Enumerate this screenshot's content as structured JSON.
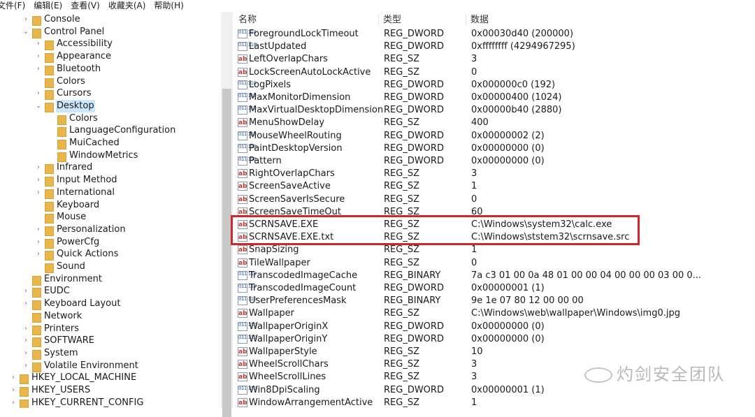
{
  "menu": [
    "文件(F)",
    "编辑(E)",
    "查看(V)",
    "收藏夹(A)",
    "帮助(H)"
  ],
  "tree": [
    {
      "label": "Console",
      "arrow": "›",
      "indent": 0
    },
    {
      "label": "Control Panel",
      "arrow": "⌄",
      "indent": 0
    },
    {
      "label": "Accessibility",
      "arrow": "›",
      "indent": 1
    },
    {
      "label": "Appearance",
      "arrow": "›",
      "indent": 1
    },
    {
      "label": "Bluetooth",
      "arrow": "›",
      "indent": 1
    },
    {
      "label": "Colors",
      "arrow": "",
      "indent": 1
    },
    {
      "label": "Cursors",
      "arrow": "›",
      "indent": 1
    },
    {
      "label": "Desktop",
      "arrow": "⌄",
      "indent": 1,
      "selected": true
    },
    {
      "label": "Colors",
      "arrow": "",
      "indent": 2
    },
    {
      "label": "LanguageConfiguration",
      "arrow": "",
      "indent": 2
    },
    {
      "label": "MuiCached",
      "arrow": "",
      "indent": 2
    },
    {
      "label": "WindowMetrics",
      "arrow": "",
      "indent": 2
    },
    {
      "label": "Infrared",
      "arrow": "›",
      "indent": 1
    },
    {
      "label": "Input Method",
      "arrow": "›",
      "indent": 1
    },
    {
      "label": "International",
      "arrow": "›",
      "indent": 1
    },
    {
      "label": "Keyboard",
      "arrow": "",
      "indent": 1
    },
    {
      "label": "Mouse",
      "arrow": "",
      "indent": 1
    },
    {
      "label": "Personalization",
      "arrow": "›",
      "indent": 1
    },
    {
      "label": "PowerCfg",
      "arrow": "›",
      "indent": 1
    },
    {
      "label": "Quick Actions",
      "arrow": "›",
      "indent": 1
    },
    {
      "label": "Sound",
      "arrow": "",
      "indent": 1
    },
    {
      "label": "Environment",
      "arrow": "",
      "indent": 0
    },
    {
      "label": "EUDC",
      "arrow": "›",
      "indent": 0
    },
    {
      "label": "Keyboard Layout",
      "arrow": "›",
      "indent": 0
    },
    {
      "label": "Network",
      "arrow": "",
      "indent": 0
    },
    {
      "label": "Printers",
      "arrow": "›",
      "indent": 0
    },
    {
      "label": "SOFTWARE",
      "arrow": "›",
      "indent": 0
    },
    {
      "label": "System",
      "arrow": "›",
      "indent": 0
    },
    {
      "label": "Volatile Environment",
      "arrow": "›",
      "indent": 0
    },
    {
      "label": "HKEY_LOCAL_MACHINE",
      "arrow": "›",
      "indent": -1
    },
    {
      "label": "HKEY_USERS",
      "arrow": "›",
      "indent": -1
    },
    {
      "label": "HKEY_CURRENT_CONFIG",
      "arrow": "›",
      "indent": -1
    }
  ],
  "columns": {
    "name": "名称",
    "type": "类型",
    "data": "数据"
  },
  "values": [
    {
      "icon": "dword",
      "name": "ForegroundLockTimeout",
      "type": "REG_DWORD",
      "data": "0x00030d40 (200000)"
    },
    {
      "icon": "dword",
      "name": "LastUpdated",
      "type": "REG_DWORD",
      "data": "0xffffffff (4294967295)"
    },
    {
      "icon": "sz",
      "name": "LeftOverlapChars",
      "type": "REG_SZ",
      "data": "3"
    },
    {
      "icon": "sz",
      "name": "LockScreenAutoLockActive",
      "type": "REG_SZ",
      "data": "0"
    },
    {
      "icon": "dword",
      "name": "LogPixels",
      "type": "REG_DWORD",
      "data": "0x000000c0 (192)"
    },
    {
      "icon": "dword",
      "name": "MaxMonitorDimension",
      "type": "REG_DWORD",
      "data": "0x00000400 (1024)"
    },
    {
      "icon": "dword",
      "name": "MaxVirtualDesktopDimension",
      "type": "REG_DWORD",
      "data": "0x00000b40 (2880)"
    },
    {
      "icon": "sz",
      "name": "MenuShowDelay",
      "type": "REG_SZ",
      "data": "400"
    },
    {
      "icon": "dword",
      "name": "MouseWheelRouting",
      "type": "REG_DWORD",
      "data": "0x00000002 (2)"
    },
    {
      "icon": "dword",
      "name": "PaintDesktopVersion",
      "type": "REG_DWORD",
      "data": "0x00000000 (0)"
    },
    {
      "icon": "dword",
      "name": "Pattern",
      "type": "REG_DWORD",
      "data": "0x00000000 (0)"
    },
    {
      "icon": "sz",
      "name": "RightOverlapChars",
      "type": "REG_SZ",
      "data": "3"
    },
    {
      "icon": "sz",
      "name": "ScreenSaveActive",
      "type": "REG_SZ",
      "data": "1"
    },
    {
      "icon": "sz",
      "name": "ScreenSaverIsSecure",
      "type": "REG_SZ",
      "data": "0"
    },
    {
      "icon": "sz",
      "name": "ScreenSaveTimeOut",
      "type": "REG_SZ",
      "data": "60"
    },
    {
      "icon": "sz",
      "name": "SCRNSAVE.EXE",
      "type": "REG_SZ",
      "data": "C:\\Windows\\system32\\calc.exe"
    },
    {
      "icon": "sz",
      "name": "SCRNSAVE.EXE.txt",
      "type": "REG_SZ",
      "data": "C:\\Windows\\ststem32\\scrnsave.src"
    },
    {
      "icon": "sz",
      "name": "SnapSizing",
      "type": "REG_SZ",
      "data": "1"
    },
    {
      "icon": "sz",
      "name": "TileWallpaper",
      "type": "REG_SZ",
      "data": "0"
    },
    {
      "icon": "dword",
      "name": "TranscodedImageCache",
      "type": "REG_BINARY",
      "data": "7a c3 01 00 0a 48 01 00 00 04 00 00 00 03 00 0..."
    },
    {
      "icon": "dword",
      "name": "TranscodedImageCount",
      "type": "REG_DWORD",
      "data": "0x00000001 (1)"
    },
    {
      "icon": "dword",
      "name": "UserPreferencesMask",
      "type": "REG_BINARY",
      "data": "9e 1e 07 80 12 00 00 00"
    },
    {
      "icon": "sz",
      "name": "Wallpaper",
      "type": "REG_SZ",
      "data": "C:\\Windows\\web\\wallpaper\\Windows\\img0.jpg"
    },
    {
      "icon": "dword",
      "name": "WallpaperOriginX",
      "type": "REG_DWORD",
      "data": "0x00000000 (0)"
    },
    {
      "icon": "dword",
      "name": "WallpaperOriginY",
      "type": "REG_DWORD",
      "data": "0x00000000 (0)"
    },
    {
      "icon": "sz",
      "name": "WallpaperStyle",
      "type": "REG_SZ",
      "data": "10"
    },
    {
      "icon": "sz",
      "name": "WheelScrollChars",
      "type": "REG_SZ",
      "data": "3"
    },
    {
      "icon": "sz",
      "name": "WheelScrollLines",
      "type": "REG_SZ",
      "data": "3"
    },
    {
      "icon": "dword",
      "name": "Win8DpiScaling",
      "type": "REG_DWORD",
      "data": "0x00000001 (1)"
    },
    {
      "icon": "sz",
      "name": "WindowArrangementActive",
      "type": "REG_SZ",
      "data": "1"
    }
  ],
  "watermark": "灼剑安全团队",
  "colors": {
    "highlight_box": "#d3252b",
    "selected_bg": "#cce8ff",
    "folder": "#e8b64b"
  }
}
